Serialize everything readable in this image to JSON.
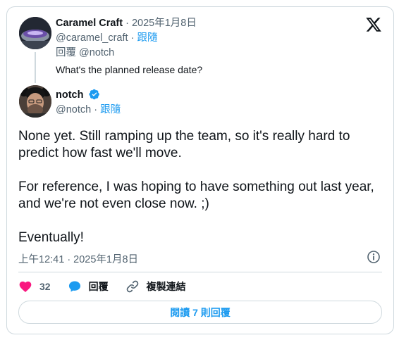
{
  "parent_tweet": {
    "author_name": "Caramel Craft",
    "separator": "·",
    "date": "2025年1月8日",
    "handle": "@caramel_craft",
    "follow_label": "跟隨",
    "reply_to_label": "回覆",
    "reply_to_handle": "@notch",
    "text": "What's the planned release date?"
  },
  "main_tweet": {
    "author_name": "notch",
    "handle": "@notch",
    "separator": "·",
    "follow_label": "跟隨",
    "paragraphs": [
      "None yet. Still ramping up the team, so it's really hard to predict how fast we'll move.",
      "For reference, I was hoping to have something out last year, and we're not even close now. ;)",
      "Eventually!"
    ],
    "timestamp": "上午12:41 · 2025年1月8日"
  },
  "actions": {
    "like_count": "32",
    "reply_label": "回覆",
    "copy_link_label": "複製連結"
  },
  "read_replies_label": "閱讀 7 則回覆",
  "colors": {
    "accent": "#1d9bf0",
    "like": "#f91880",
    "text": "#0f1419",
    "muted": "#536471",
    "border": "#cfd9de"
  },
  "icons": [
    "x-logo-icon",
    "verified-badge-icon",
    "info-icon",
    "heart-icon",
    "reply-bubble-icon",
    "link-icon"
  ]
}
